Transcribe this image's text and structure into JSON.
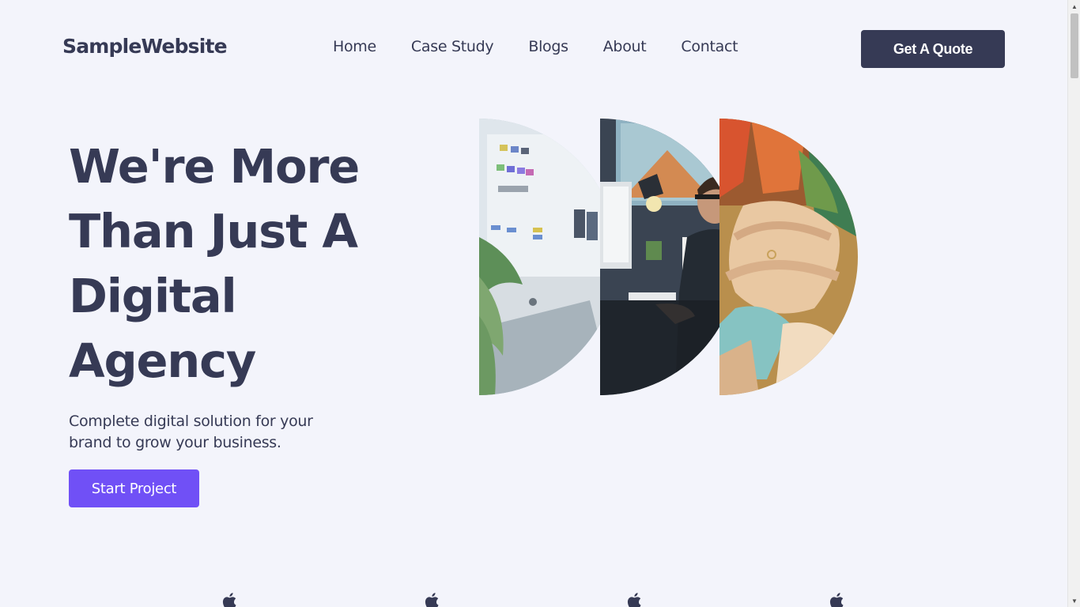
{
  "header": {
    "logo": "SampleWebsite",
    "nav": [
      "Home",
      "Case Study",
      "Blogs",
      "About",
      "Contact"
    ],
    "cta": "Get A Quote"
  },
  "hero": {
    "title": "We're More Than Just A Digital Agency",
    "subtitle": "Complete digital solution for your brand to grow your business.",
    "button": "Start Project",
    "images": [
      "design-workspace-photo",
      "designer-at-desk-photo",
      "team-hands-photo"
    ]
  },
  "brands": [
    "apple-icon",
    "apple-icon",
    "apple-icon",
    "apple-icon"
  ],
  "colors": {
    "background": "#f3f4fb",
    "text": "#363a55",
    "primary": "#7050f6",
    "dark_button": "#363a55"
  }
}
